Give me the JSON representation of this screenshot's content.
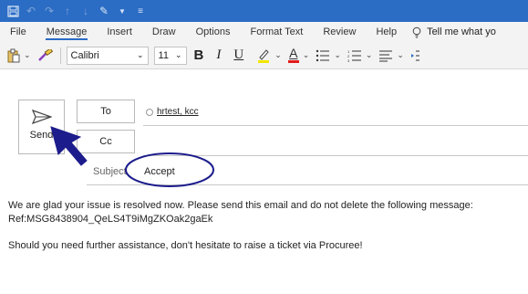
{
  "menu": {
    "items": [
      "File",
      "Message",
      "Insert",
      "Draw",
      "Options",
      "Format Text",
      "Review",
      "Help"
    ],
    "active_index": 1,
    "tell_me": "Tell me what yo"
  },
  "ribbon": {
    "font_name": "Calibri",
    "font_size": "11",
    "bold_label": "B",
    "italic_label": "I",
    "underline_label": "U",
    "font_color_label": "A",
    "highlight_color": "#f2e600",
    "font_color": "#e21b1b"
  },
  "compose": {
    "send_label": "Send",
    "to_label": "To",
    "cc_label": "Cc",
    "recipient": "hrtest, kcc",
    "subject_label": "Subject",
    "subject_value": "Accept"
  },
  "body": {
    "line1": "We are glad your issue is resolved now. Please send this email and do not delete the following message:",
    "line2": "Ref:MSG8438904_QeLS4T9iMgZKOak2gaEk",
    "line3": "Should you need further  assistance, don't hesitate to raise a ticket via Procuree!"
  },
  "colors": {
    "titlebar": "#2b6cc4",
    "annotation": "#1c1c8c"
  }
}
